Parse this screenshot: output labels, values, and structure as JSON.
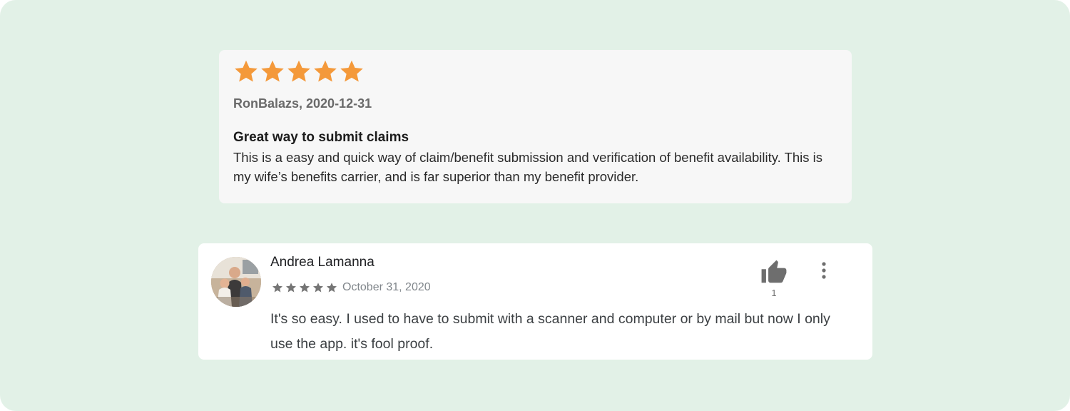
{
  "colors": {
    "background": "#e2f1e7",
    "star_large": "#f4993a",
    "star_small": "#757575",
    "thumb_icon": "#6e6e6e"
  },
  "appstore_review": {
    "rating": 5,
    "max_rating": 5,
    "author_date": "RonBalazs, 2020-12-31",
    "title": "Great way to submit claims",
    "body": "This is a easy and quick way of claim/benefit submission and verification of benefit availability. This is my wife’s benefits carrier, and is far superior than my benefit provider."
  },
  "playstore_review": {
    "author": "Andrea Lamanna",
    "rating": 5,
    "max_rating": 5,
    "date": "October 31, 2020",
    "helpful_count": "1",
    "body": "It's so easy. I used to have to submit with a scanner and computer or by mail but now I only use the app. it's fool proof.",
    "icons": {
      "helpful": "thumbs-up-icon",
      "more": "more-vert-icon"
    }
  }
}
